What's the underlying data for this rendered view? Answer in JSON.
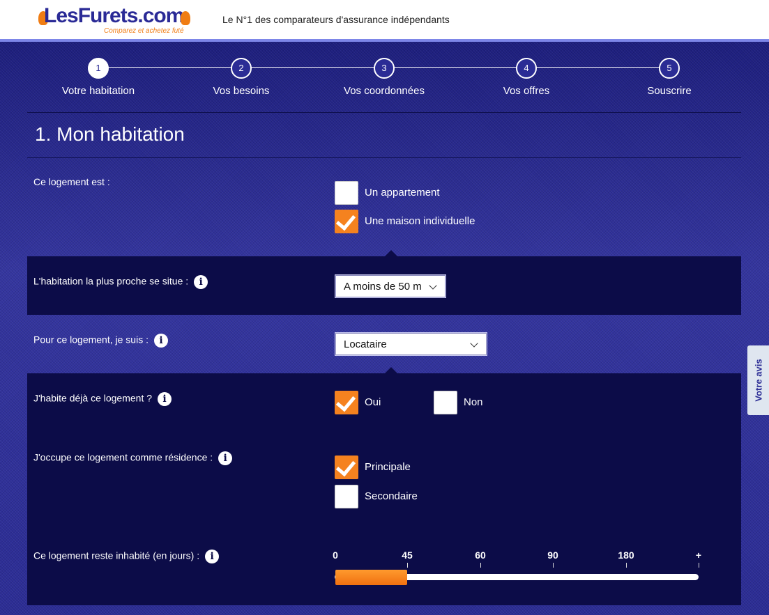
{
  "header": {
    "logo_text": "LesFurets.com",
    "logo_tagline": "Comparez et achetez futé",
    "tagline": "Le N°1 des comparateurs d'assurance indépendants"
  },
  "colors": {
    "brand_blue": "#2b2c95",
    "dark_panel": "#0c0c48",
    "accent_orange": "#f5821f"
  },
  "stepper": {
    "steps": [
      {
        "number": "1",
        "label": "Votre habitation",
        "active": true
      },
      {
        "number": "2",
        "label": "Vos besoins",
        "active": false
      },
      {
        "number": "3",
        "label": "Vos coordonnées",
        "active": false
      },
      {
        "number": "4",
        "label": "Vos offres",
        "active": false
      },
      {
        "number": "5",
        "label": "Souscrire",
        "active": false
      }
    ]
  },
  "section": {
    "title": "1. Mon habitation"
  },
  "form": {
    "housing_type": {
      "label": "Ce logement est :",
      "options": [
        {
          "label": "Un appartement",
          "checked": false
        },
        {
          "label": "Une maison individuelle",
          "checked": true
        }
      ]
    },
    "nearest_dwelling": {
      "label": "L'habitation la plus proche se situe :",
      "info_icon": "info-icon",
      "selected": "A moins de 50 m"
    },
    "occupant_status": {
      "label": "Pour ce logement, je suis :",
      "info_icon": "info-icon",
      "selected": "Locataire"
    },
    "already_living": {
      "label": "J'habite déjà ce logement ?",
      "info_icon": "info-icon",
      "options": [
        {
          "label": "Oui",
          "checked": true
        },
        {
          "label": "Non",
          "checked": false
        }
      ]
    },
    "residence_type": {
      "label": "J'occupe ce logement comme résidence :",
      "info_icon": "info-icon",
      "options": [
        {
          "label": "Principale",
          "checked": true
        },
        {
          "label": "Secondaire",
          "checked": false
        }
      ]
    },
    "uninhabited_days": {
      "label": "Ce logement reste inhabité (en jours) :",
      "info_icon": "info-icon",
      "ticks": [
        "0",
        "45",
        "60",
        "90",
        "180",
        "+"
      ],
      "selected_index": 1
    }
  },
  "side_tab": {
    "label": "Votre avis"
  }
}
